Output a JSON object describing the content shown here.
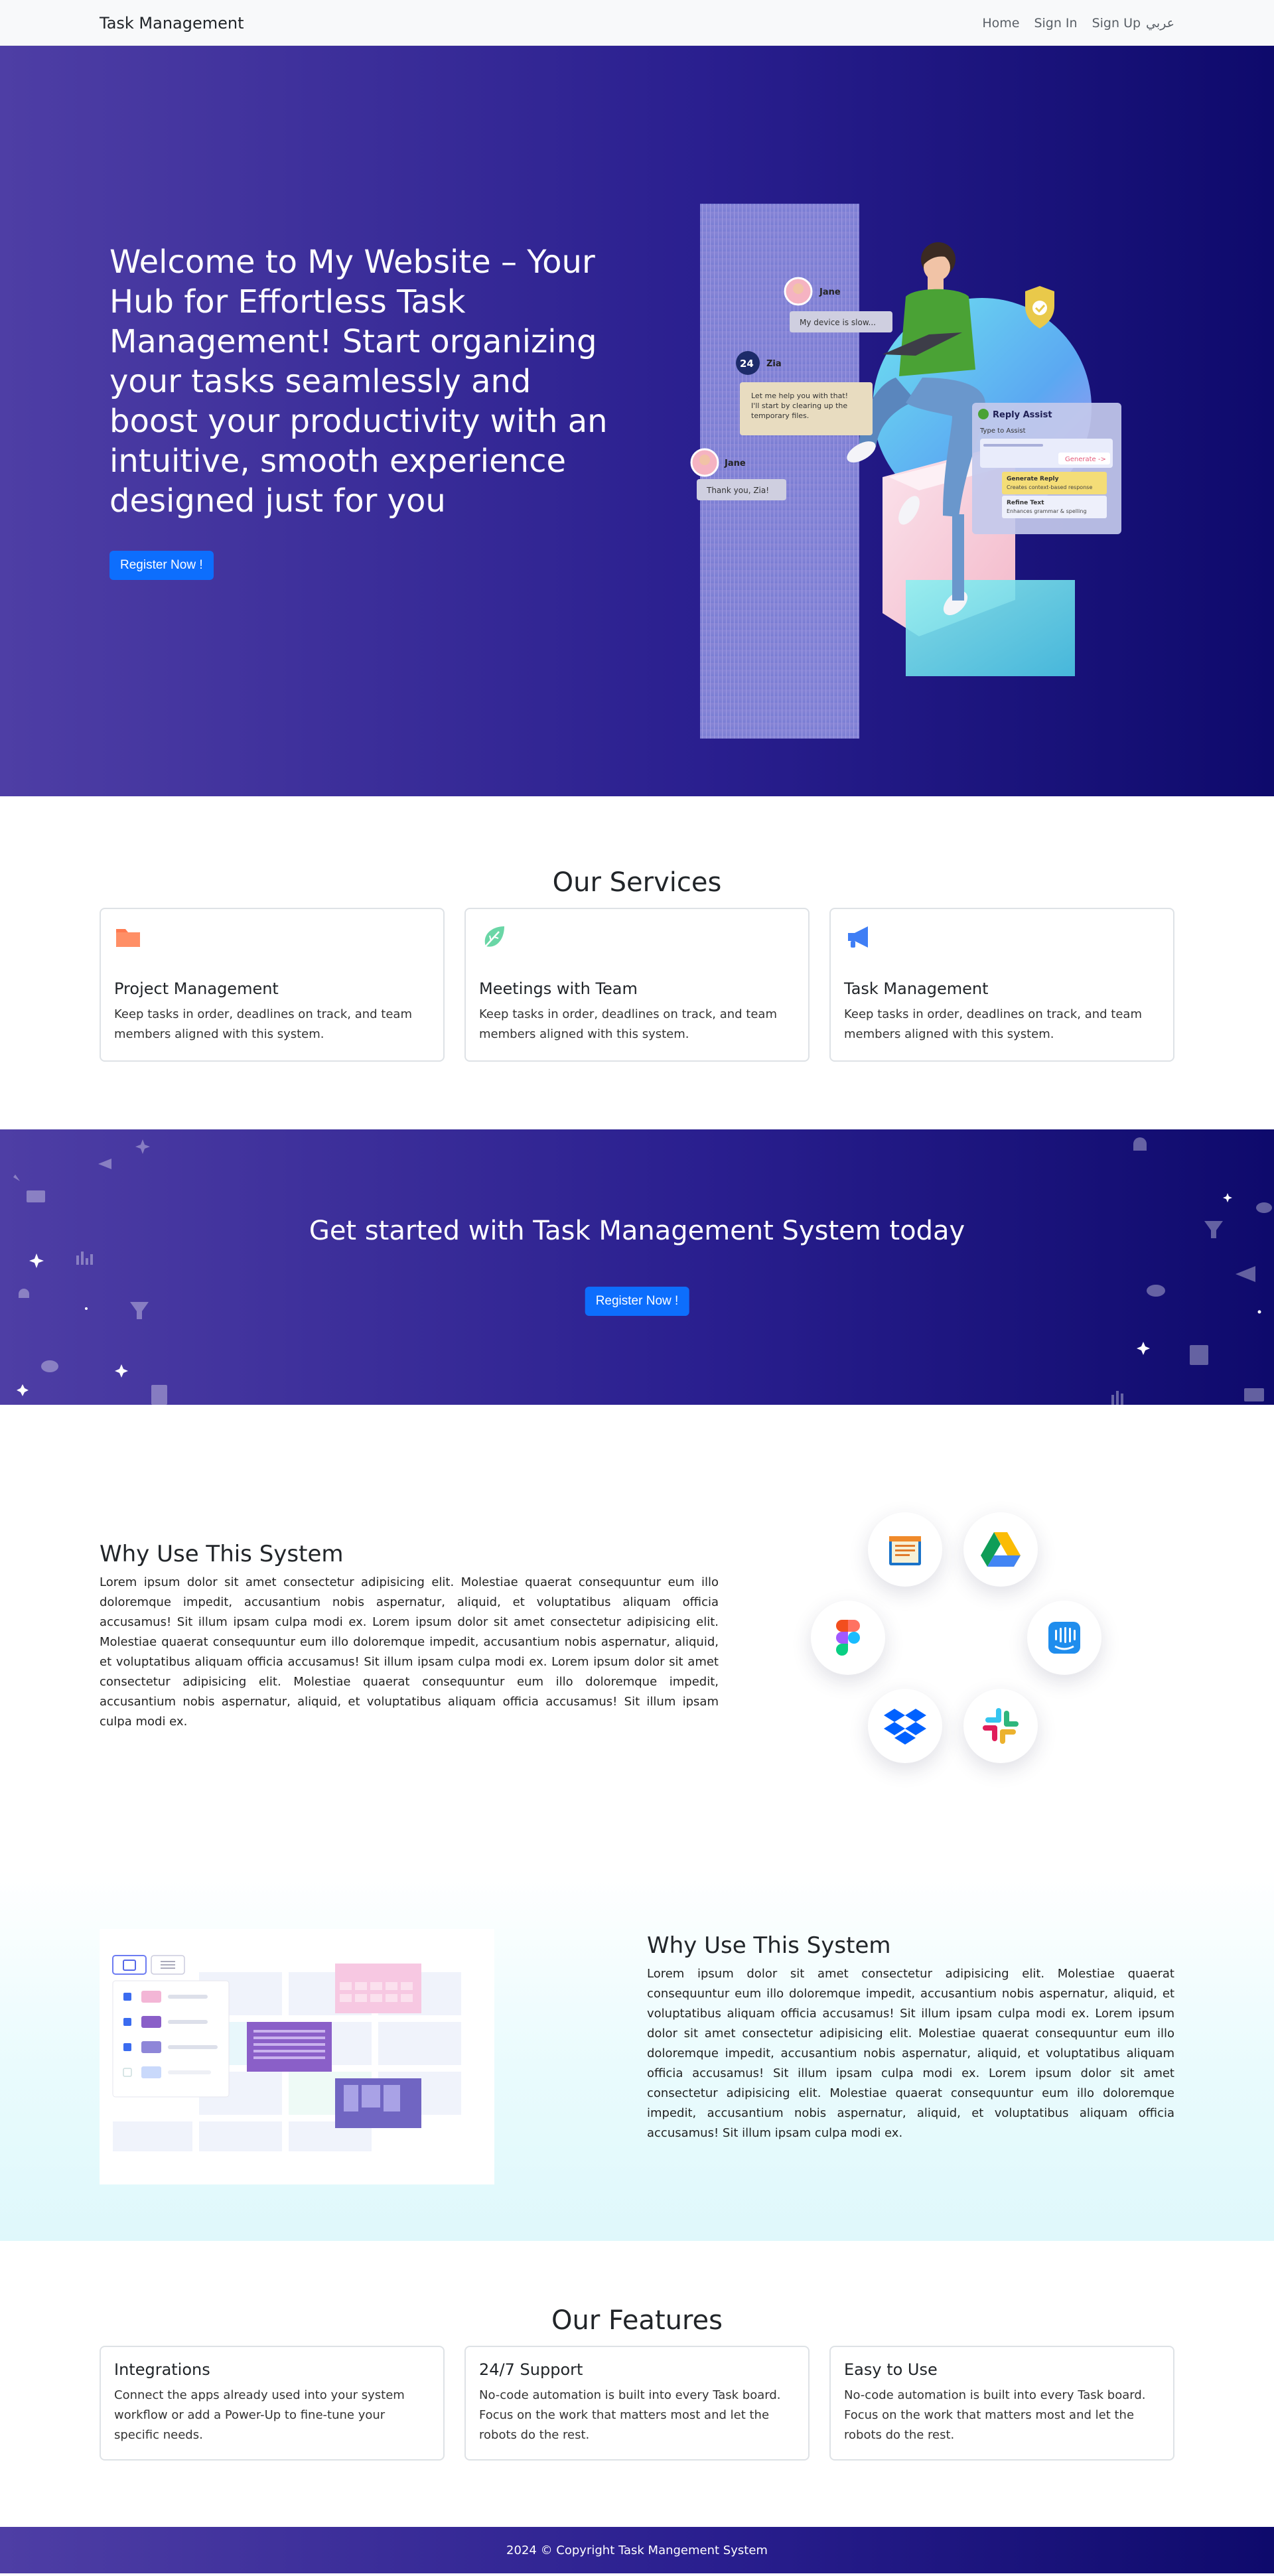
{
  "navbar": {
    "brand": "Task Management",
    "links": [
      "Home",
      "Sign In",
      "Sign Up"
    ],
    "lang": "عربي"
  },
  "hero": {
    "title": "Welcome to My Website – Your Hub for Effortless Task Management! Start organizing your tasks seamlessly and boost your productivity with an intuitive, smooth experience designed just for you",
    "button": "Register Now !",
    "illustration": {
      "chat": [
        {
          "name": "Jane",
          "message": "My device is slow..."
        },
        {
          "name": "Zia",
          "message": "Let me help you with that! I'll start by clearing up the temporary files."
        },
        {
          "name": "Jane",
          "message": "Thank you, Zia!"
        }
      ],
      "zia_badge": "Zia",
      "reply_assist": {
        "title": "Reply Assist",
        "subtitle": "Type to Assist",
        "generate_button": "Generate ->",
        "options": [
          {
            "title": "Generate Reply",
            "desc": "Creates context-based response"
          },
          {
            "title": "Refine Text",
            "desc": "Enhances grammar & spelling"
          }
        ]
      }
    }
  },
  "services": {
    "title": "Our Services",
    "cards": [
      {
        "icon": "folder-icon",
        "title": "Project Management",
        "text": "Keep tasks in order, deadlines on track, and team members aligned with this system."
      },
      {
        "icon": "leaf-icon",
        "title": "Meetings with Team",
        "text": "Keep tasks in order, deadlines on track, and team members aligned with this system."
      },
      {
        "icon": "megaphone-icon",
        "title": "Task Management",
        "text": "Keep tasks in order, deadlines on track, and team members aligned with this system."
      }
    ]
  },
  "cta": {
    "title": "Get started with Task Management System today",
    "button": "Register Now !"
  },
  "why1": {
    "title": "Why Use This System",
    "text": "Lorem ipsum dolor sit amet consectetur adipisicing elit. Molestiae quaerat consequuntur eum illo doloremque impedit, accusantium nobis aspernatur, aliquid, et voluptatibus aliquam officia accusamus! Sit illum ipsam culpa modi ex. Lorem ipsum dolor sit amet consectetur adipisicing elit. Molestiae quaerat consequuntur eum illo doloremque impedit, accusantium nobis aspernatur, aliquid, et voluptatibus aliquam officia accusamus! Sit illum ipsam culpa modi ex. Lorem ipsum dolor sit amet consectetur adipisicing elit. Molestiae quaerat consequuntur eum illo doloremque impedit, accusantium nobis aspernatur, aliquid, et voluptatibus aliquam officia accusamus! Sit illum ipsam culpa modi ex.",
    "apps": [
      "calendar-app-icon",
      "google-drive-icon",
      "figma-icon",
      "intercom-icon",
      "dropbox-icon",
      "slack-icon"
    ]
  },
  "why2": {
    "title": "Why Use This System",
    "text": "Lorem ipsum dolor sit amet consectetur adipisicing elit. Molestiae quaerat consequuntur eum illo doloremque impedit, accusantium nobis aspernatur, aliquid, et voluptatibus aliquam officia accusamus! Sit illum ipsam culpa modi ex. Lorem ipsum dolor sit amet consectetur adipisicing elit. Molestiae quaerat consequuntur eum illo doloremque impedit, accusantium nobis aspernatur, aliquid, et voluptatibus aliquam officia accusamus! Sit illum ipsam culpa modi ex. Lorem ipsum dolor sit amet consectetur adipisicing elit. Molestiae quaerat consequuntur eum illo doloremque impedit, accusantium nobis aspernatur, aliquid, et voluptatibus aliquam officia accusamus! Sit illum ipsam culpa modi ex."
  },
  "features": {
    "title": "Our Features",
    "cards": [
      {
        "title": "Integrations",
        "text": "Connect the apps already used into your system workflow or add a Power-Up to fine-tune your specific needs."
      },
      {
        "title": "24/7 Support",
        "text": "No-code automation is built into every Task board. Focus on the work that matters most and let the robots do the rest."
      },
      {
        "title": "Easy to Use",
        "text": "No-code automation is built into every Task board. Focus on the work that matters most and let the robots do the rest."
      }
    ]
  },
  "footer": {
    "copyright": "2024 © Copyright Task Mangement System"
  },
  "colors": {
    "primary": "#0d6efd",
    "gradient_start": "#4e3ea5",
    "gradient_end": "#0e0a6c",
    "navbar_bg": "#f8f9fa"
  }
}
